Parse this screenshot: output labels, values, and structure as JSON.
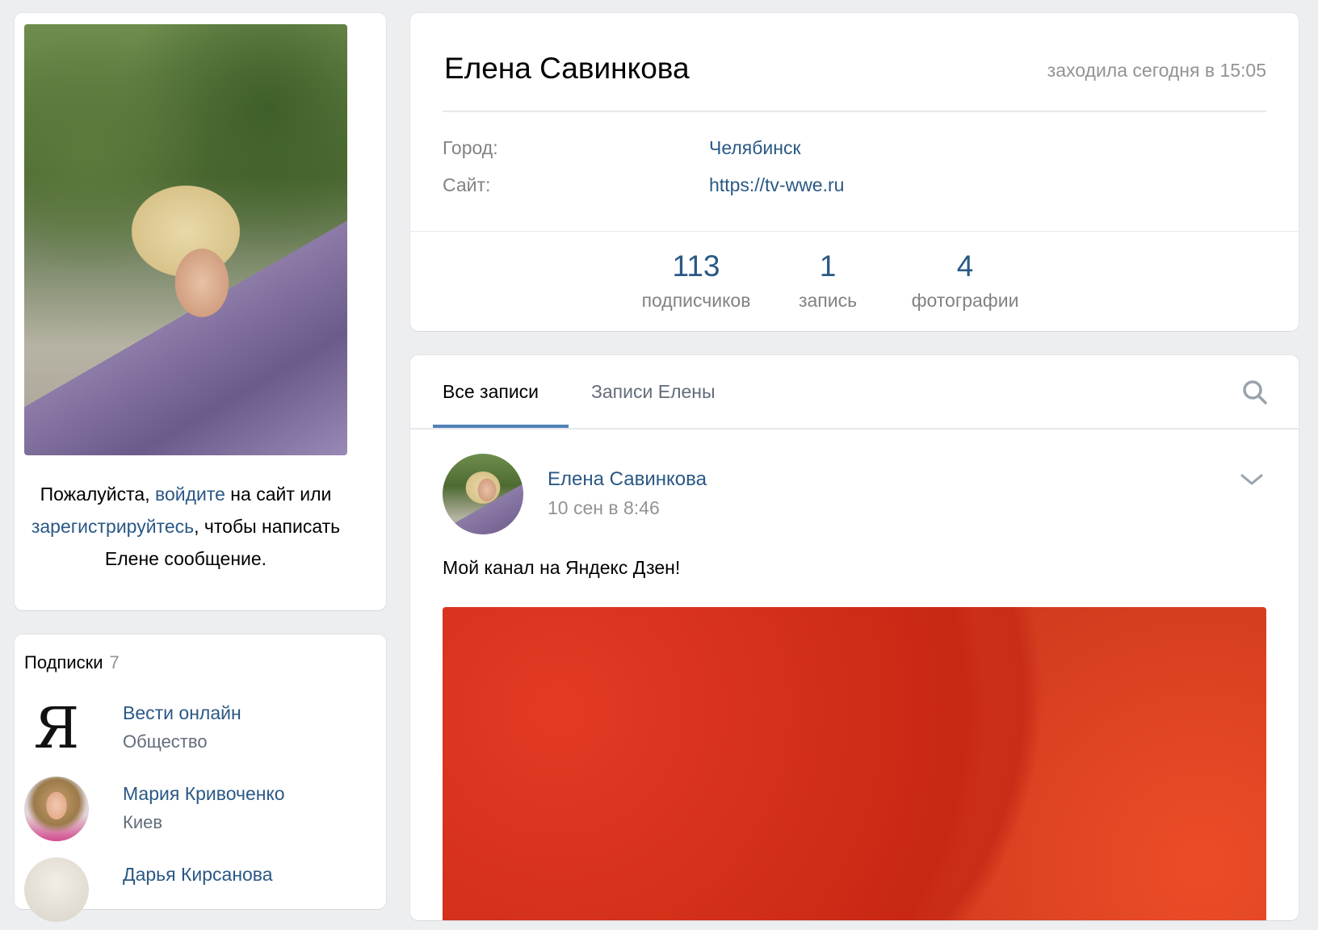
{
  "left": {
    "auth": {
      "part1": "Пожалуйста, ",
      "login_link": "войдите",
      "part2": " на сайт или ",
      "register_link": "зарегистрируйтесь",
      "part3": ", чтобы написать Елене сообщение."
    },
    "subscriptions": {
      "title": "Подписки",
      "count": "7",
      "items": [
        {
          "name": "Вести онлайн",
          "desc": "Общество",
          "avatar_glyph": "Я"
        },
        {
          "name": "Мария Кривоченко",
          "desc": "Киев"
        },
        {
          "name": "Дарья Кирсанова",
          "desc": ""
        }
      ]
    }
  },
  "profile": {
    "name": "Елена Савинкова",
    "last_seen": "заходила сегодня в 15:05",
    "info": [
      {
        "label": "Город:",
        "value": "Челябинск"
      },
      {
        "label": "Сайт:",
        "value": "https://tv-wwe.ru"
      }
    ],
    "counters": [
      {
        "num": "113",
        "label": "подписчиков"
      },
      {
        "num": "1",
        "label": "запись"
      },
      {
        "num": "4",
        "label": "фотографии"
      }
    ]
  },
  "wall": {
    "tabs": [
      {
        "label": "Все записи",
        "active": true
      },
      {
        "label": "Записи Елены",
        "active": false
      }
    ],
    "post": {
      "author": "Елена Савинкова",
      "date": "10 сен в 8:46",
      "text": "Мой канал на Яндекс Дзен!"
    }
  },
  "icons": {
    "search": "search-icon",
    "chevron": "chevron-down-icon"
  },
  "colors": {
    "link": "#2a5885",
    "accent": "#5181b8",
    "background": "#edeef0",
    "muted": "#939393"
  }
}
